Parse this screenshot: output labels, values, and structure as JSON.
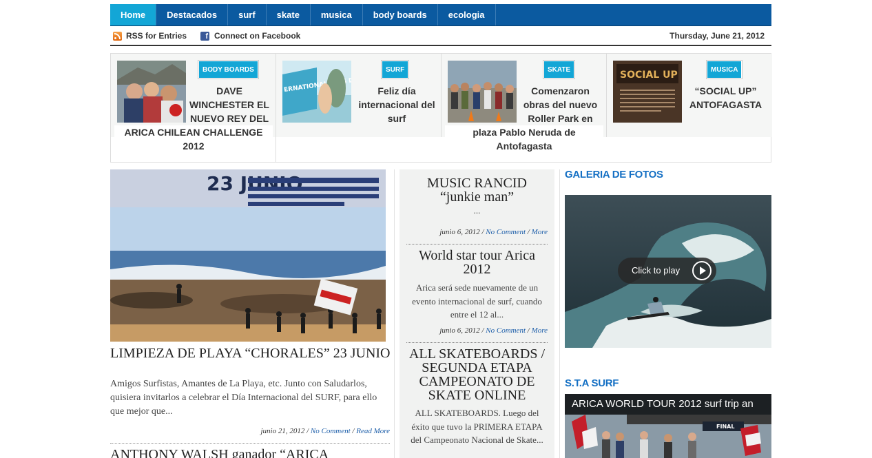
{
  "nav": {
    "items": [
      {
        "label": "Home",
        "active": true
      },
      {
        "label": "Destacados"
      },
      {
        "label": "surf"
      },
      {
        "label": "skate"
      },
      {
        "label": "musica"
      },
      {
        "label": "body boards"
      },
      {
        "label": "ecologia"
      }
    ],
    "colors": {
      "bar": "#0b5aa0",
      "active": "#13a6d6"
    }
  },
  "topbar": {
    "rss_label": "RSS for Entries",
    "facebook_label": "Connect on Facebook",
    "date": "Thursday, June 21, 2012"
  },
  "featured": [
    {
      "category": "BODY BOARDS",
      "title_top": "DAVE",
      "title_side": "WINCHESTER EL NUEVO REY DEL",
      "title_bottom": "ARICA CHILEAN CHALLENGE 2012"
    },
    {
      "category": "SURF",
      "title": "Feliz día internacional del surf",
      "thumb_text": "ERNATIONAL FING DAY"
    },
    {
      "category": "SKATE",
      "title_side": "Comenzaron obras del nuevo Roller Park en",
      "title_bottom": "plaza Pablo Neruda de Antofagasta"
    },
    {
      "category": "MUSICA",
      "title": "“SOCIAL UP” ANTOFAGASTA",
      "thumb_text": "SOCIAL UP"
    }
  ],
  "main_post": {
    "image_text": "23 JUNIO",
    "title": "LIMPIEZA DE PLAYA “CHORALES” 23 JUNIO",
    "excerpt": "Amigos Surfistas, Amantes de La Playa, etc. Junto con Saludarlos, quisiera invitarlos a celebrar el Día Internacional del SURF, para ello que mejor que...",
    "date": "junio 21, 2012",
    "comments": "No Comment",
    "read_more": "Read More",
    "separator": "/"
  },
  "next_post_title": "ANTHONY WALSH ganador “ARICA",
  "mid_posts": [
    {
      "title": "MUSIC RANCID “junkie man”",
      "excerpt": "...",
      "date": "junio 6, 2012",
      "comments": "No Comment",
      "more": "More"
    },
    {
      "title": "World star tour Arica 2012",
      "excerpt": "Arica será sede nuevamente de un evento internacional de surf, cuando entre el 12 al...",
      "date": "junio 6, 2012",
      "comments": "No Comment",
      "more": "More"
    },
    {
      "title": "ALL SKATEBOARDS / SEGUNDA ETAPA CAMPEONATO DE SKATE ONLINE",
      "excerpt": "ALL SKATEBOARDS. Luego del éxito que tuvo la PRIMERA ETAPA del Campeonato Nacional de Skate..."
    }
  ],
  "sidebar": {
    "gallery_title": "GALERIA DE FOTOS",
    "play_label": "Click to play",
    "sta_title": "S.T.A SURF",
    "video_title": "ARICA WORLD TOUR 2012 surf trip an",
    "video_badge": "FINAL",
    "accent": "#1570c4"
  }
}
